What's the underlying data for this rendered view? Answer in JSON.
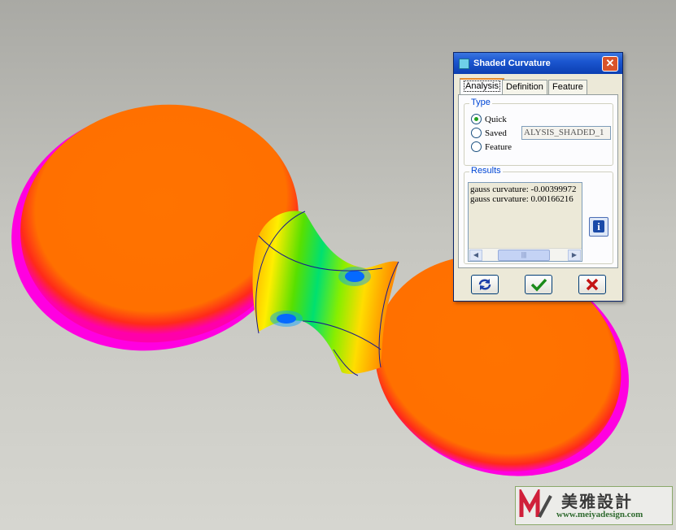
{
  "dialog": {
    "title": "Shaded Curvature",
    "close_icon": "close-icon",
    "tabs": [
      {
        "label": "Analysis",
        "active": true
      },
      {
        "label": "Definition",
        "active": false
      },
      {
        "label": "Feature",
        "active": false
      }
    ],
    "type_group": {
      "label": "Type",
      "options": [
        {
          "label": "Quick",
          "checked": true
        },
        {
          "label": "Saved",
          "checked": false
        },
        {
          "label": "Feature",
          "checked": false
        }
      ],
      "saved_name_value": "ALYSIS_SHADED_1"
    },
    "results_group": {
      "label": "Results",
      "lines": [
        "gauss curvature: -0.00399972",
        "gauss curvature: 0.00166216"
      ],
      "info_icon": "info-icon"
    },
    "buttons": {
      "repaint_icon": "repaint-icon",
      "ok_icon": "checkmark-icon",
      "cancel_icon": "cancel-x-icon"
    }
  },
  "watermark": {
    "brand": "美雅設計",
    "url": "www.meiyadesign.com"
  },
  "colors": {
    "surface_flat": "#ff7300",
    "edge_red": "#ff0033",
    "edge_magenta": "#ff00ff",
    "dialog_bg": "#ece9d8",
    "titlebar_blue": "#0c3fb2"
  }
}
